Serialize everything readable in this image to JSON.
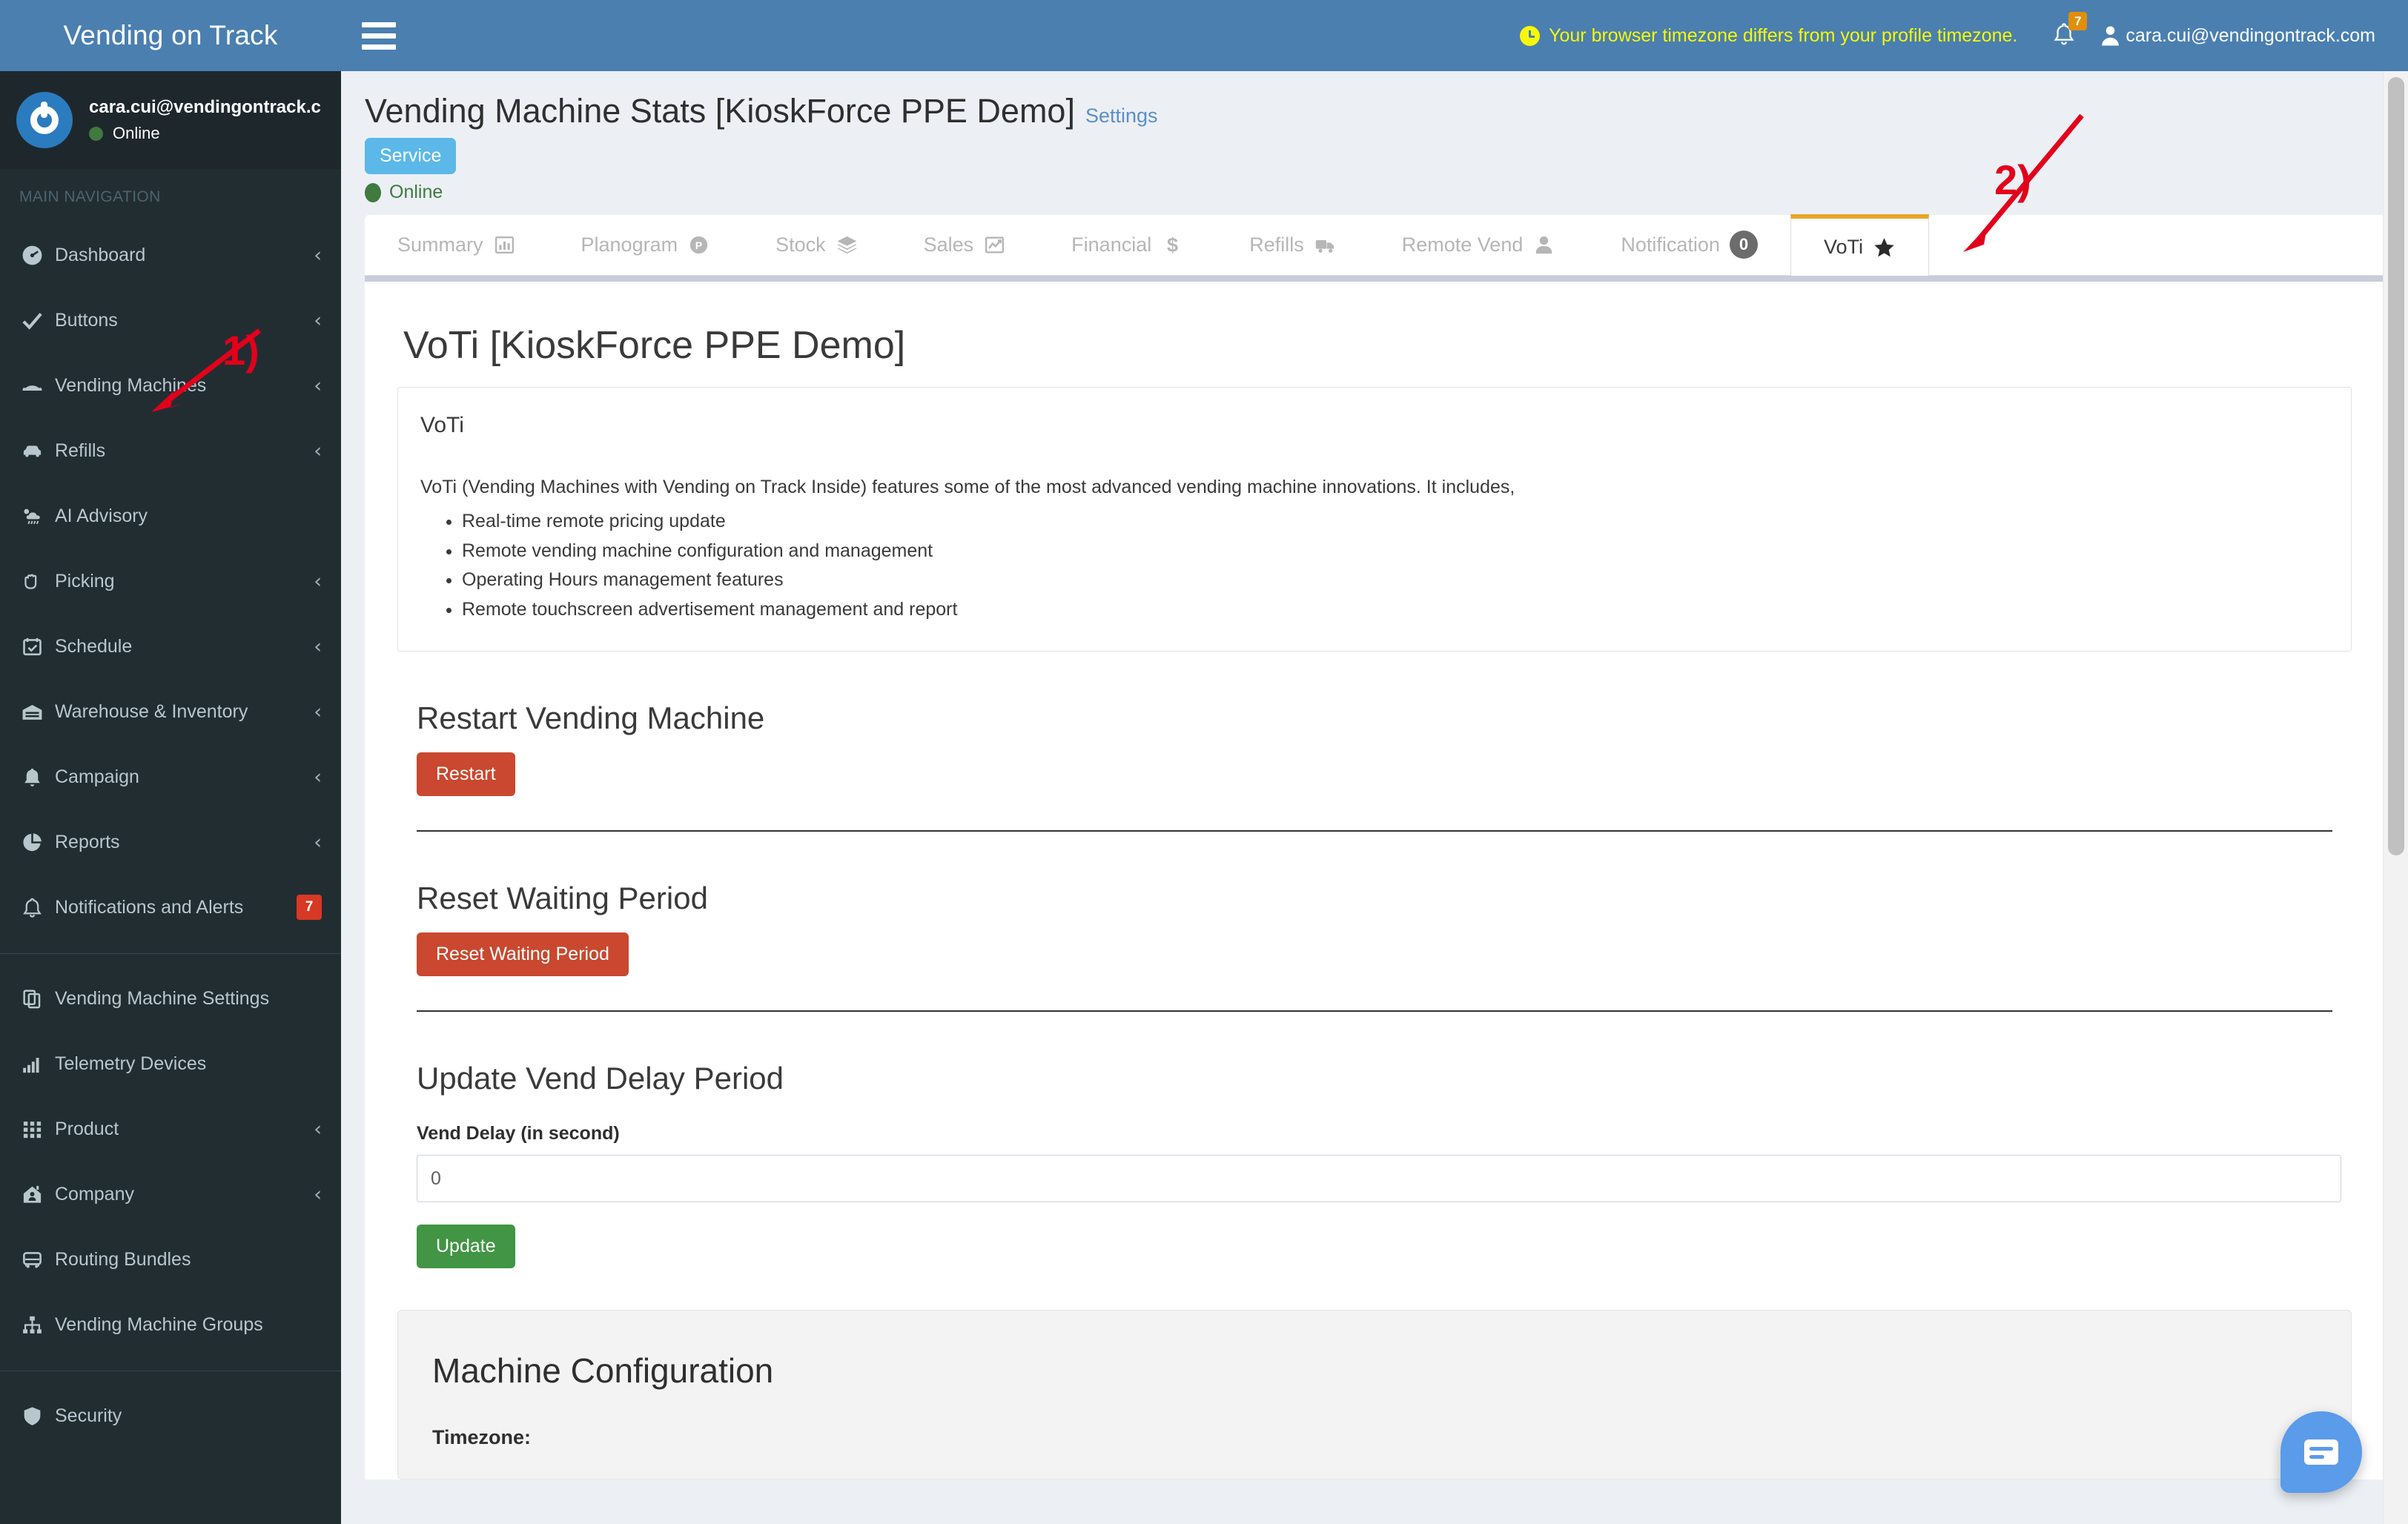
{
  "header": {
    "brand": "Vending on Track",
    "menu_icon": "hamburger-icon",
    "timezone_warning": "Your browser timezone differs from your profile timezone.",
    "notification_count": "7",
    "user_email": "cara.cui@vendingontrack.com"
  },
  "sidebar": {
    "user_email": "cara.cui@vendingontrack.c",
    "user_status": "Online",
    "nav_header": "MAIN NAVIGATION",
    "items": [
      {
        "label": "Dashboard",
        "icon": "dashboard-icon",
        "caret": "‹",
        "badge": null
      },
      {
        "label": "Buttons",
        "icon": "check-icon",
        "caret": "‹",
        "badge": null
      },
      {
        "label": "Vending Machines",
        "icon": "vending-machine-icon",
        "caret": "‹",
        "badge": null
      },
      {
        "label": "Refills",
        "icon": "car-icon",
        "caret": "‹",
        "badge": null
      },
      {
        "label": "AI Advisory",
        "icon": "cloud-rain-icon",
        "caret": "",
        "badge": null
      },
      {
        "label": "Picking",
        "icon": "hand-icon",
        "caret": "‹",
        "badge": null
      },
      {
        "label": "Schedule",
        "icon": "calendar-check-icon",
        "caret": "‹",
        "badge": null
      },
      {
        "label": "Warehouse & Inventory",
        "icon": "warehouse-icon",
        "caret": "‹",
        "badge": null
      },
      {
        "label": "Campaign",
        "icon": "bell-solid-icon",
        "caret": "‹",
        "badge": null
      },
      {
        "label": "Reports",
        "icon": "pie-chart-icon",
        "caret": "‹",
        "badge": null
      },
      {
        "label": "Notifications and Alerts",
        "icon": "bell-outline-icon",
        "caret": "",
        "badge": "7"
      }
    ],
    "items2": [
      {
        "label": "Vending Machine Settings",
        "icon": "copy-icon",
        "caret": "",
        "badge": null
      },
      {
        "label": "Telemetry Devices",
        "icon": "signal-bars-icon",
        "caret": "",
        "badge": null
      },
      {
        "label": "Product",
        "icon": "grid-icon",
        "caret": "‹",
        "badge": null
      },
      {
        "label": "Company",
        "icon": "company-home-icon",
        "caret": "‹",
        "badge": null
      },
      {
        "label": "Routing Bundles",
        "icon": "bus-icon",
        "caret": "",
        "badge": null
      },
      {
        "label": "Vending Machine Groups",
        "icon": "sitemap-icon",
        "caret": "",
        "badge": null
      }
    ],
    "items3": [
      {
        "label": "Security",
        "icon": "shield-icon",
        "caret": "",
        "badge": null
      }
    ]
  },
  "page": {
    "title": "Vending Machine Stats [KioskForce PPE Demo]",
    "settings_link": "Settings",
    "service_badge": "Service",
    "online_status": "Online"
  },
  "tabs": [
    {
      "label": "Summary",
      "icon": "bar-chart-icon",
      "active": false,
      "pill": null
    },
    {
      "label": "Planogram",
      "icon": "planogram-p-icon",
      "active": false,
      "pill": null
    },
    {
      "label": "Stock",
      "icon": "layers-icon",
      "active": false,
      "pill": null
    },
    {
      "label": "Sales",
      "icon": "line-chart-icon",
      "active": false,
      "pill": null
    },
    {
      "label": "Financial",
      "icon": "dollar-icon",
      "active": false,
      "pill": null
    },
    {
      "label": "Refills",
      "icon": "truck-icon",
      "active": false,
      "pill": null
    },
    {
      "label": "Remote Vend",
      "icon": "user-icon",
      "active": false,
      "pill": null
    },
    {
      "label": "Notification",
      "icon": "",
      "active": false,
      "pill": "0"
    },
    {
      "label": "VoTi",
      "icon": "star-icon",
      "active": true,
      "pill": null
    }
  ],
  "main": {
    "heading": "VoTi [KioskForce PPE Demo]",
    "box_title": "VoTi",
    "description": "VoTi (Vending Machines with Vending on Track Inside) features some of the most advanced vending machine innovations. It includes,",
    "features": [
      "Real-time remote pricing update",
      "Remote vending machine configuration and management",
      "Operating Hours management features",
      "Remote touchscreen advertisement management and report"
    ],
    "restart_section_title": "Restart Vending Machine",
    "restart_button": "Restart",
    "reset_section_title": "Reset Waiting Period",
    "reset_button": "Reset Waiting Period",
    "vend_delay_section_title": "Update Vend Delay Period",
    "vend_delay_label": "Vend Delay (in second)",
    "vend_delay_value": "0",
    "update_button": "Update",
    "machine_config_title": "Machine Configuration",
    "timezone_label": "Timezone:"
  },
  "annotations": [
    {
      "label": "1)"
    },
    {
      "label": "2)"
    }
  ],
  "chat": {
    "icon": "chat-bubble-icon"
  },
  "colors": {
    "brand_blue": "#4a7fb0",
    "sidebar_dark": "#222d32",
    "accent_orange": "#e8a628",
    "danger_red": "#c9482f",
    "success_green": "#419544",
    "badge_red": "#d73925",
    "annotation_red": "#e3001b"
  }
}
